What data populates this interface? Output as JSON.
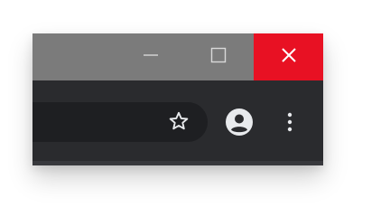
{
  "window_controls": {
    "minimize": {
      "icon": "minimize-icon"
    },
    "maximize": {
      "icon": "maximize-icon"
    },
    "close": {
      "icon": "close-icon",
      "background": "#e81123"
    }
  },
  "toolbar": {
    "omnibox": {
      "icon": "star-icon"
    },
    "profile": {
      "icon": "account-circle-icon"
    },
    "menu": {
      "icon": "more-vertical-icon"
    }
  },
  "colors": {
    "titlebar": "#7b7b7b",
    "toolbar": "#2a2b2e",
    "omnibox": "#1e1f22",
    "icon": "#e8eaed",
    "close_hover": "#e81123"
  }
}
